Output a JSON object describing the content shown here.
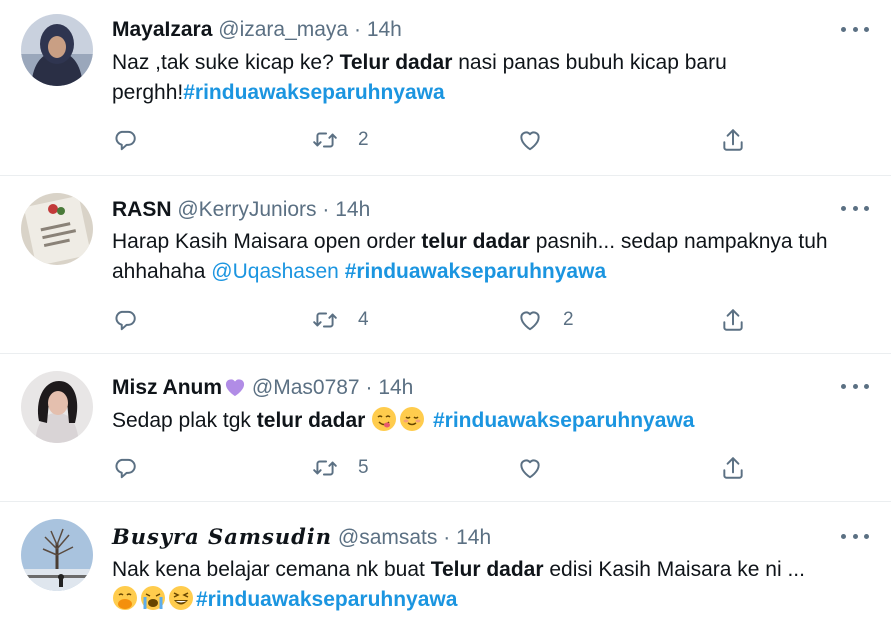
{
  "tweets": [
    {
      "display_name": "MayaIzara",
      "handle": "@izara_maya",
      "separator": "·",
      "time": "14h",
      "text": {
        "t1": "Naz ,tak suke kicap ke? ",
        "bold": "Telur dadar",
        "t2": " nasi panas bubuh kicap baru perghh!",
        "hashtag": "#rinduawakseparuhnyawa"
      },
      "reply_count": "",
      "retweet_count": "2",
      "like_count": ""
    },
    {
      "display_name": "RASN",
      "handle": "@KerryJuniors",
      "separator": "·",
      "time": "14h",
      "text": {
        "t1": "Harap Kasih Maisara open order ",
        "bold": "telur dadar",
        "t2": " pasnih... sedap nampaknya tuh ahhahaha ",
        "mention": "@Uqashasen",
        "t3": " ",
        "hashtag": "#rinduawakseparuhnyawa"
      },
      "reply_count": "",
      "retweet_count": "4",
      "like_count": "2"
    },
    {
      "display_name": "Misz Anum",
      "name_emoji": "purple-heart-icon",
      "handle": "@Mas0787",
      "separator": "·",
      "time": "14h",
      "text": {
        "t1": "Sedap plak tgk ",
        "bold": "telur dadar",
        "emojis": [
          "face-savoring-food-icon",
          "smiling-face-icon"
        ],
        "hashtag": "#rinduawakseparuhnyawa"
      },
      "reply_count": "",
      "retweet_count": "5",
      "like_count": ""
    },
    {
      "display_name": "Busyra Samsudin",
      "handle": "@samsats",
      "separator": "·",
      "time": "14h",
      "text": {
        "t1": "Nak kena belajar cemana nk buat ",
        "bold": "Telur dadar",
        "t2": "  edisi Kasih Maisara ke ni ...",
        "emojis": [
          "face-with-hand-over-mouth-icon",
          "loudly-crying-face-icon",
          "grinning-squinting-face-icon"
        ],
        "hashtag": "#rinduawakseparuhnyawa"
      }
    }
  ],
  "colors": {
    "text": "#0f1419",
    "secondary": "#5b7083",
    "link": "#1b95e0",
    "divider": "#ebeef0"
  }
}
